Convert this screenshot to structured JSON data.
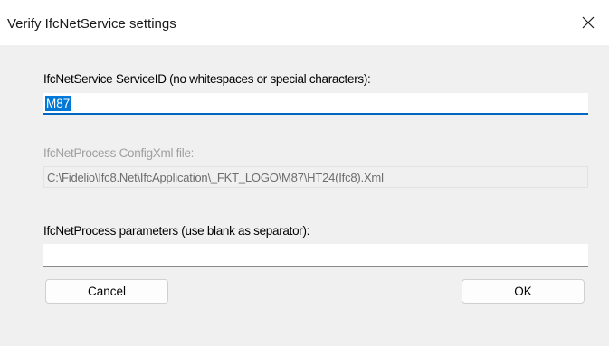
{
  "window": {
    "title": "Verify IfcNetService settings",
    "close_icon": "close-icon"
  },
  "service_id": {
    "label": "IfcNetService ServiceID (no whitespaces or special characters):",
    "value": "M87"
  },
  "config_xml": {
    "label": "IfcNetProcess ConfigXml file:",
    "value": "C:\\Fidelio\\Ifc8.Net\\IfcApplication\\_FKT_LOGO\\M87\\HT24(Ifc8).Xml"
  },
  "process_params": {
    "label": "IfcNetProcess parameters (use blank as separator):",
    "value": ""
  },
  "buttons": {
    "cancel_label": "Cancel",
    "ok_label": "OK"
  },
  "colors": {
    "accent": "#0067c0",
    "selection": "#0078d7",
    "dialog_bg": "#f0f0f0",
    "disabled_text": "#a0a0a0"
  }
}
